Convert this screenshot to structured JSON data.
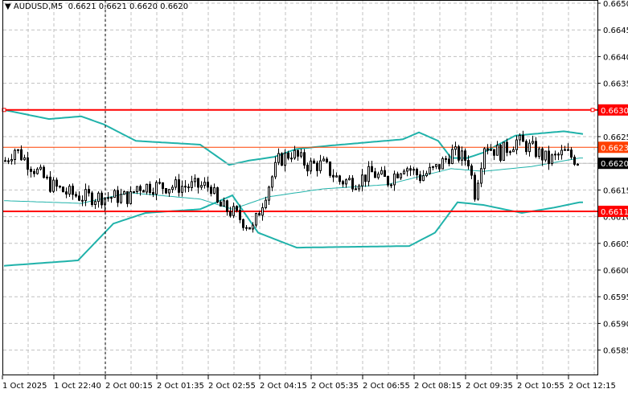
{
  "header": {
    "symbol": "AUDUSD,M5",
    "ohlc": "0.6621 0.6621 0.6620 0.6620"
  },
  "colors": {
    "grid": "#c0c0c0",
    "bands": "#20b2aa",
    "level": "#ff0000",
    "orange": "#ff4000",
    "bull": "#ffffff",
    "bear": "#000000"
  },
  "chart_data": {
    "type": "candlestick",
    "title": "AUDUSD,M5",
    "ylim": [
      0.658,
      0.6652
    ],
    "y_ticks": [
      "0.6650",
      "0.6645",
      "0.6640",
      "0.6635",
      "0.6630",
      "0.6625",
      "0.6620",
      "0.6615",
      "0.6610",
      "0.6605",
      "0.6600",
      "0.6595",
      "0.6590",
      "0.6585"
    ],
    "x_ticks": [
      "1 Oct 2025",
      "1 Oct 22:40",
      "2 Oct 00:15",
      "2 Oct 01:35",
      "2 Oct 02:55",
      "2 Oct 04:15",
      "2 Oct 05:35",
      "2 Oct 06:55",
      "2 Oct 08:15",
      "2 Oct 09:35",
      "2 Oct 10:55",
      "2 Oct 12:15"
    ],
    "bars_count": 179,
    "close_path": [
      [
        0,
        0.66205
      ],
      [
        3,
        0.66227
      ],
      [
        9,
        0.6619
      ],
      [
        14,
        0.6616
      ],
      [
        19,
        0.66145
      ],
      [
        24,
        0.66137
      ],
      [
        39,
        0.66137
      ],
      [
        41,
        0.66157
      ],
      [
        64,
        0.66157
      ],
      [
        66,
        0.66122
      ],
      [
        71,
        0.66107
      ],
      [
        77,
        0.66077
      ],
      [
        81,
        0.66145
      ],
      [
        85,
        0.66205
      ],
      [
        89,
        0.6622
      ],
      [
        94,
        0.66197
      ],
      [
        99,
        0.66197
      ],
      [
        104,
        0.66167
      ],
      [
        109,
        0.66167
      ],
      [
        114,
        0.66182
      ],
      [
        119,
        0.66167
      ],
      [
        124,
        0.66197
      ],
      [
        129,
        0.66175
      ],
      [
        134,
        0.6619
      ],
      [
        139,
        0.6622
      ],
      [
        144,
        0.66205
      ],
      [
        146,
        0.66145
      ],
      [
        149,
        0.66235
      ],
      [
        154,
        0.6622
      ],
      [
        159,
        0.66242
      ],
      [
        164,
        0.66227
      ],
      [
        169,
        0.66205
      ],
      [
        174,
        0.6622
      ],
      [
        178,
        0.66205
      ]
    ],
    "bollinger_upper": [
      [
        0,
        0.663
      ],
      [
        14,
        0.66283
      ],
      [
        24,
        0.66288
      ],
      [
        31,
        0.66273
      ],
      [
        41,
        0.66242
      ],
      [
        61,
        0.66235
      ],
      [
        70,
        0.66197
      ],
      [
        76,
        0.66205
      ],
      [
        84,
        0.66212
      ],
      [
        91,
        0.66227
      ],
      [
        101,
        0.66233
      ],
      [
        124,
        0.66245
      ],
      [
        129,
        0.66258
      ],
      [
        135,
        0.66242
      ],
      [
        139,
        0.6621
      ],
      [
        144,
        0.6621
      ],
      [
        149,
        0.6622
      ],
      [
        159,
        0.66252
      ],
      [
        174,
        0.6626
      ],
      [
        180,
        0.66255
      ]
    ],
    "bollinger_middle": [
      [
        0,
        0.6613
      ],
      [
        24,
        0.66125
      ],
      [
        39,
        0.66145
      ],
      [
        61,
        0.66133
      ],
      [
        71,
        0.66114
      ],
      [
        82,
        0.66137
      ],
      [
        99,
        0.66152
      ],
      [
        119,
        0.6616
      ],
      [
        139,
        0.6619
      ],
      [
        149,
        0.66185
      ],
      [
        164,
        0.66194
      ],
      [
        179,
        0.6621
      ]
    ],
    "bollinger_lower": [
      [
        0,
        0.66008
      ],
      [
        23,
        0.66018
      ],
      [
        34,
        0.66087
      ],
      [
        44,
        0.66107
      ],
      [
        61,
        0.66114
      ],
      [
        71,
        0.6614
      ],
      [
        79,
        0.6607
      ],
      [
        91,
        0.66042
      ],
      [
        126,
        0.66045
      ],
      [
        134,
        0.6607
      ],
      [
        141,
        0.66127
      ],
      [
        149,
        0.66122
      ],
      [
        161,
        0.66107
      ],
      [
        171,
        0.66117
      ],
      [
        179,
        0.66127
      ]
    ],
    "levels": [
      {
        "price": 0.663,
        "label": "0.6630",
        "style": "red-thick"
      },
      {
        "price": 0.6623,
        "label": "0.6623",
        "style": "orange"
      },
      {
        "price": 0.6611,
        "label": "0.6611",
        "style": "red-thick"
      }
    ],
    "current_price": {
      "price": 0.662,
      "label": "0.6620"
    }
  }
}
